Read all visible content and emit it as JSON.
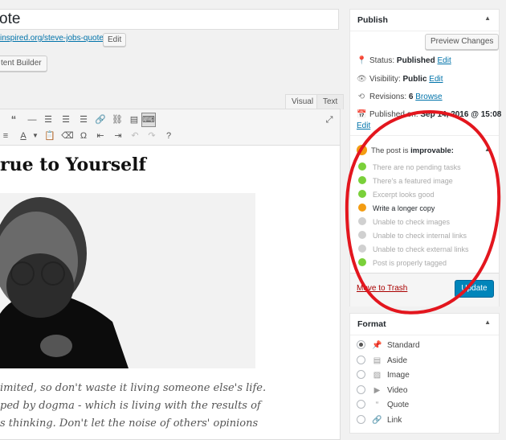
{
  "editor": {
    "title_value": "ote",
    "permalink_url": "inspired.org/steve-jobs-quote/",
    "edit_label": "Edit",
    "content_builder_label": "tent Builder",
    "tab_visual": "Visual",
    "tab_text": "Text",
    "heading": "rue to Yourself",
    "quote_lines": [
      "imited, so don't waste it living someone else's life.",
      "ped by dogma - which is living with the results of",
      "s thinking. Don't let the noise of others' opinions"
    ],
    "toolbar_icons": [
      "quote-icon",
      "hr-icon",
      "align-left-icon",
      "align-center-icon",
      "align-right-icon",
      "link-icon",
      "unlink-icon",
      "read-more-icon",
      "toolbar-toggle-icon",
      "fullscreen-icon",
      "list-icon",
      "text-color-icon",
      "paste-text-icon",
      "clear-format-icon",
      "special-char-icon",
      "outdent-icon",
      "indent-icon",
      "undo-icon",
      "redo-icon",
      "help-icon"
    ]
  },
  "publish": {
    "title": "Publish",
    "preview_label": "Preview Changes",
    "status_label": "Status:",
    "status_value": "Published",
    "visibility_label": "Visibility:",
    "visibility_value": "Public",
    "revisions_label": "Revisions:",
    "revisions_value": "6",
    "browse_label": "Browse",
    "published_label": "Published on:",
    "published_value": "Sep 14, 2016 @ 15:08",
    "edit_label": "Edit",
    "trash_label": "Move to Trash",
    "update_label": "Update"
  },
  "quality": {
    "heading_prefix": "The post is",
    "heading_value": "improvable:",
    "checks": [
      {
        "label": "There are no pending tasks",
        "status": "pass",
        "color": "#7ad03a"
      },
      {
        "label": "There's a featured image",
        "status": "pass",
        "color": "#7ad03a"
      },
      {
        "label": "Excerpt looks good",
        "status": "pass",
        "color": "#7ad03a"
      },
      {
        "label": "Write a longer copy",
        "status": "warning",
        "color": "#f39c12"
      },
      {
        "label": "Unable to check images",
        "status": "unknown",
        "color": "#d0d0d0"
      },
      {
        "label": "Unable to check internal links",
        "status": "unknown",
        "color": "#d0d0d0"
      },
      {
        "label": "Unable to check external links",
        "status": "unknown",
        "color": "#d0d0d0"
      },
      {
        "label": "Post is properly tagged",
        "status": "pass",
        "color": "#7ad03a"
      }
    ]
  },
  "format": {
    "title": "Format",
    "options": [
      {
        "label": "Standard",
        "icon": "pin-icon",
        "selected": true
      },
      {
        "label": "Aside",
        "icon": "aside-icon",
        "selected": false
      },
      {
        "label": "Image",
        "icon": "image-icon",
        "selected": false
      },
      {
        "label": "Video",
        "icon": "video-icon",
        "selected": false
      },
      {
        "label": "Quote",
        "icon": "quote-icon",
        "selected": false
      },
      {
        "label": "Link",
        "icon": "link-icon",
        "selected": false
      }
    ]
  },
  "colors": {
    "accent": "#0073aa",
    "update_button": "#0085ba",
    "annotation": "#e3161e",
    "trash": "#aa0000"
  }
}
